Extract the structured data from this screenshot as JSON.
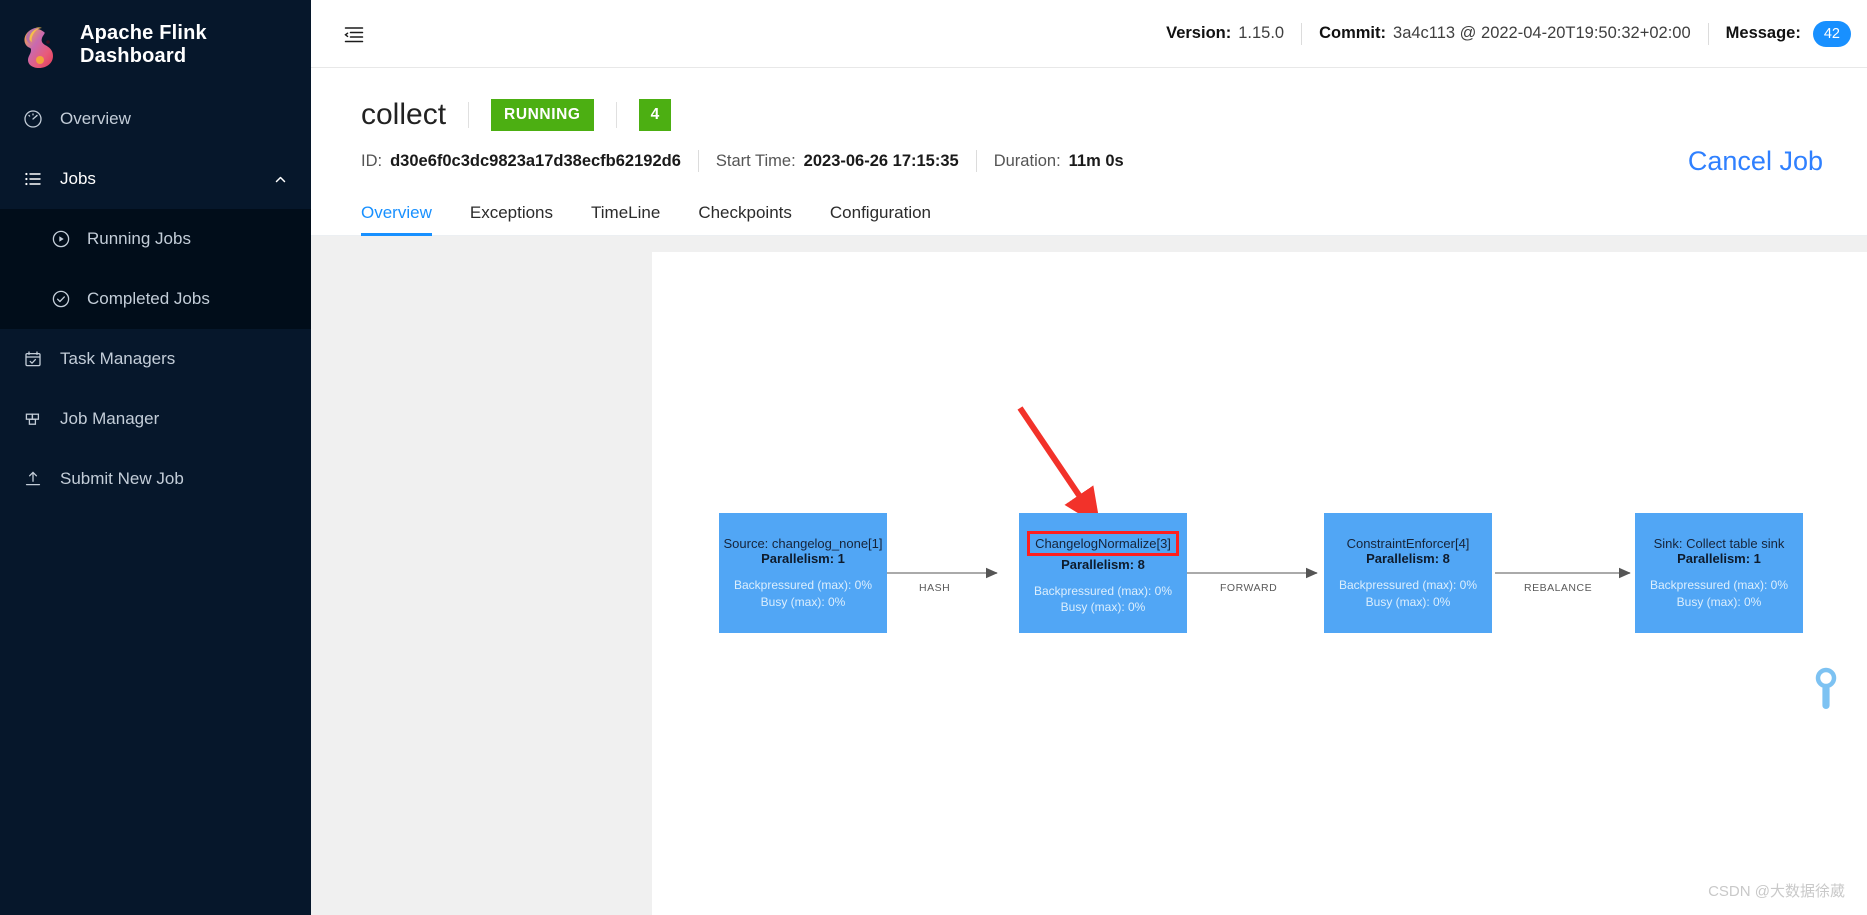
{
  "sidebar": {
    "brand": {
      "title": "Apache Flink Dashboard",
      "logo_icon": "flink-squirrel-logo"
    },
    "items": [
      {
        "label": "Overview",
        "icon": "dashboard-icon"
      },
      {
        "label": "Jobs",
        "icon": "list-icon",
        "chevron": "chevron-up-icon"
      },
      {
        "label": "Task Managers",
        "icon": "calendar-check-icon"
      },
      {
        "label": "Job Manager",
        "icon": "grid-icon"
      },
      {
        "label": "Submit New Job",
        "icon": "upload-icon"
      }
    ],
    "submenu": [
      {
        "label": "Running Jobs",
        "icon": "play-circle-icon"
      },
      {
        "label": "Completed Jobs",
        "icon": "check-circle-icon"
      }
    ]
  },
  "topbar": {
    "collapse_icon": "menu-fold-icon",
    "version_label": "Version:",
    "version_value": "1.15.0",
    "commit_label": "Commit:",
    "commit_value": "3a4c113 @ 2022-04-20T19:50:32+02:00",
    "message_label": "Message:",
    "message_count": "42"
  },
  "job": {
    "name": "collect",
    "status": "RUNNING",
    "task_count": "4",
    "id_label": "ID:",
    "id_value": "d30e6f0c3dc9823a17d38ecfb62192d6",
    "start_time_label": "Start Time:",
    "start_time_value": "2023-06-26 17:15:35",
    "duration_label": "Duration:",
    "duration_value": "11m 0s",
    "cancel_label": "Cancel Job"
  },
  "tabs": [
    {
      "label": "Overview",
      "active": true
    },
    {
      "label": "Exceptions",
      "active": false
    },
    {
      "label": "TimeLine",
      "active": false
    },
    {
      "label": "Checkpoints",
      "active": false
    },
    {
      "label": "Configuration",
      "active": false
    }
  ],
  "graph": {
    "nodes": [
      {
        "title": "Source: changelog_none[1]",
        "parallelism": "Parallelism: 1",
        "backpressured": "Backpressured (max): 0%",
        "busy": "Busy (max): 0%",
        "highlighted": false
      },
      {
        "title": "ChangelogNormalize[3]",
        "parallelism": "Parallelism: 8",
        "backpressured": "Backpressured (max): 0%",
        "busy": "Busy (max): 0%",
        "highlighted": true
      },
      {
        "title": "ConstraintEnforcer[4]",
        "parallelism": "Parallelism: 8",
        "backpressured": "Backpressured (max): 0%",
        "busy": "Busy (max): 0%",
        "highlighted": false
      },
      {
        "title": "Sink: Collect table sink",
        "parallelism": "Parallelism: 1",
        "backpressured": "Backpressured (max): 0%",
        "busy": "Busy (max): 0%",
        "highlighted": false
      }
    ],
    "edges": [
      {
        "label": "HASH"
      },
      {
        "label": "FORWARD"
      },
      {
        "label": "REBALANCE"
      }
    ],
    "annotation_arrow": "red-arrow-annotation",
    "zoom_handle_icon": "zoom-slider-handle"
  },
  "watermark": "CSDN @大数据徐葳",
  "colors": {
    "sidebar_bg": "#06172b",
    "submenu_bg": "#010d1a",
    "accent_blue": "#1890ff",
    "status_green": "#4caf12",
    "node_blue": "#51a6f5",
    "annotation_red": "#ff1f1f"
  }
}
